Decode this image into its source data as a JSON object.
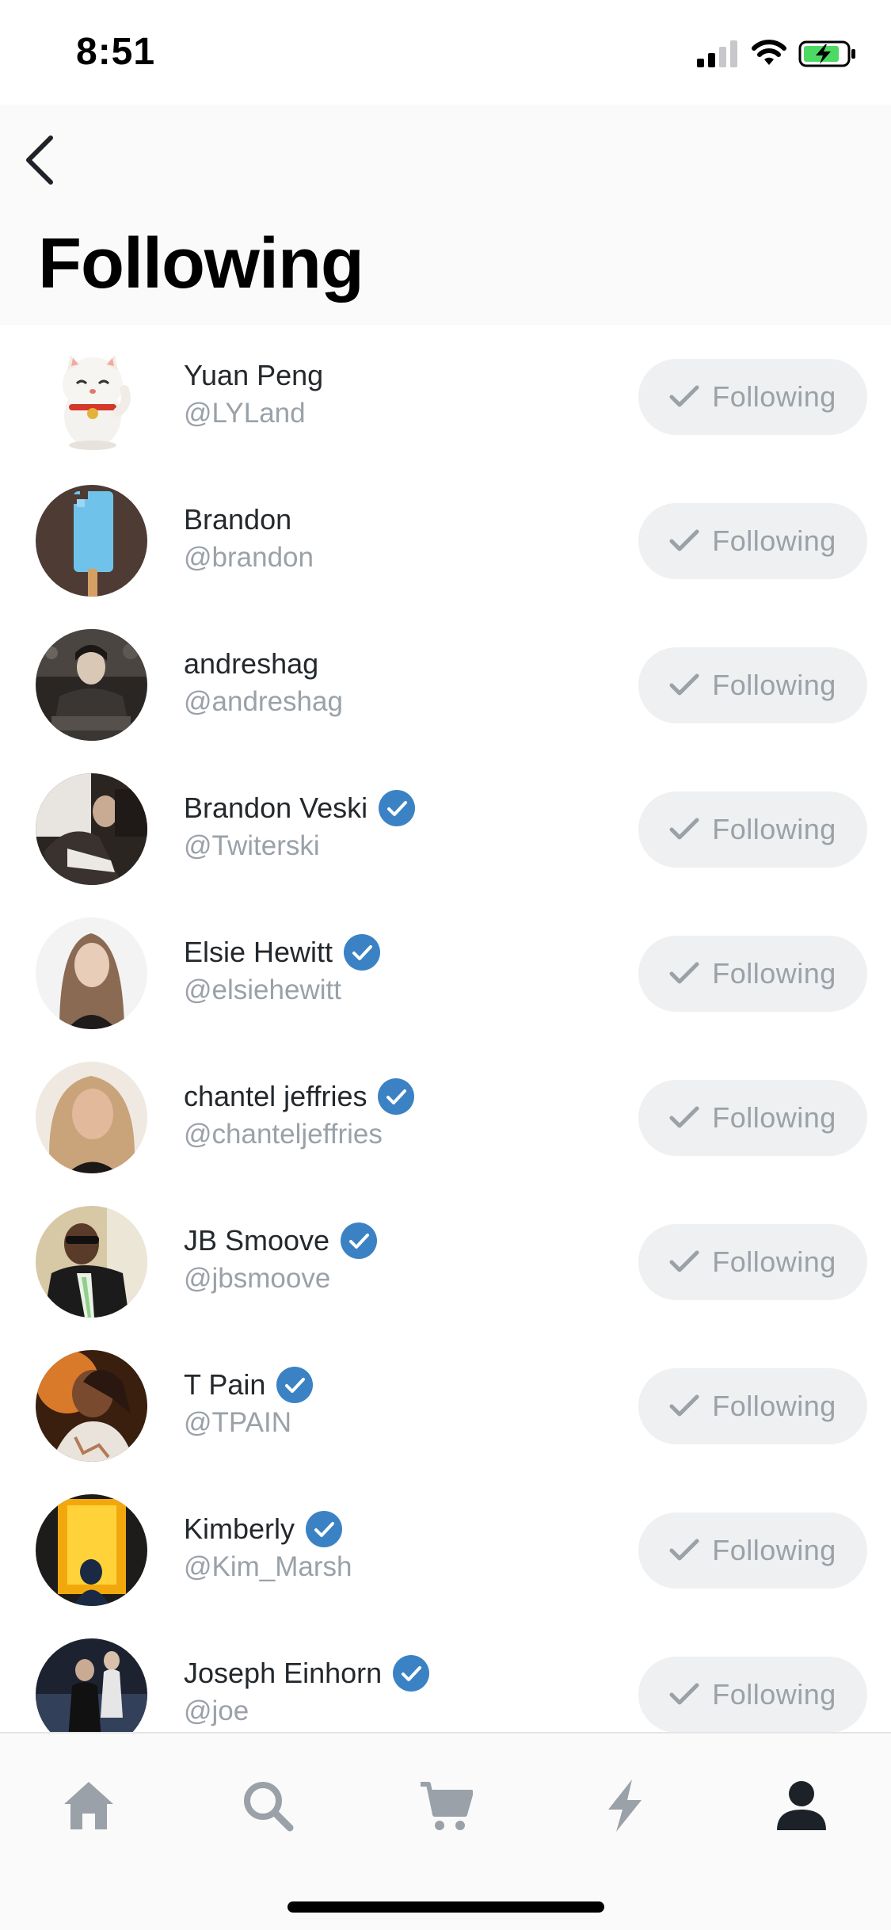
{
  "status_bar": {
    "time": "8:51"
  },
  "header": {
    "title": "Following"
  },
  "follow_button_label": "Following",
  "users": [
    {
      "name": "Yuan Peng",
      "handle": "@LYLand",
      "verified": false
    },
    {
      "name": "Brandon",
      "handle": "@brandon",
      "verified": false
    },
    {
      "name": "andreshag",
      "handle": "@andreshag",
      "verified": false
    },
    {
      "name": "Brandon Veski",
      "handle": "@Twiterski",
      "verified": true
    },
    {
      "name": "Elsie Hewitt",
      "handle": "@elsiehewitt",
      "verified": true
    },
    {
      "name": "chantel jeffries",
      "handle": "@chanteljeffries",
      "verified": true
    },
    {
      "name": "JB Smoove",
      "handle": "@jbsmoove",
      "verified": true
    },
    {
      "name": "T Pain",
      "handle": "@TPAIN",
      "verified": true
    },
    {
      "name": "Kimberly",
      "handle": "@Kim_Marsh",
      "verified": true
    },
    {
      "name": "Joseph Einhorn",
      "handle": "@joe",
      "verified": true
    }
  ],
  "tabs": [
    {
      "icon": "home-icon",
      "active": false
    },
    {
      "icon": "search-icon",
      "active": false
    },
    {
      "icon": "cart-icon",
      "active": false
    },
    {
      "icon": "lightning-icon",
      "active": false
    },
    {
      "icon": "profile-icon",
      "active": true
    }
  ],
  "colors": {
    "verified": "#3b82c4",
    "tab_inactive": "#9aa1a8",
    "tab_active": "#1d2228",
    "button_bg": "#eef0f2"
  }
}
